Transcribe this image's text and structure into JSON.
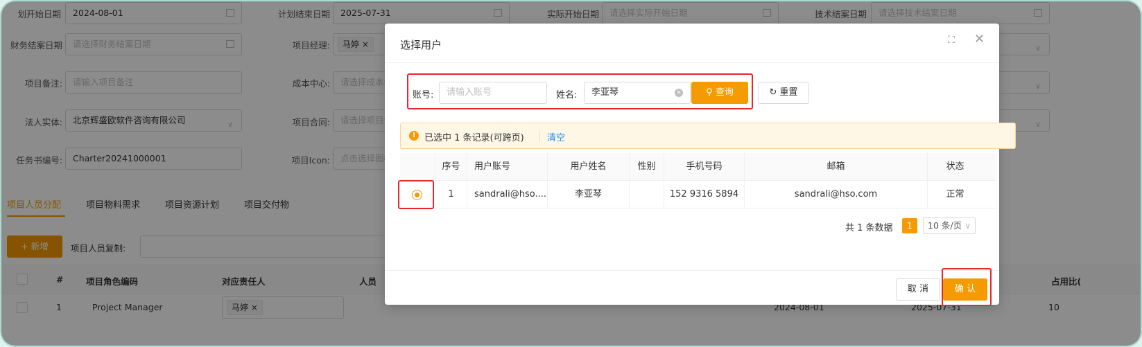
{
  "form": {
    "row1": [
      {
        "label": "划开始日期",
        "value": "2024-08-01",
        "placeholder": ""
      },
      {
        "label": "计划结束日期",
        "value": "2025-07-31",
        "placeholder": ""
      },
      {
        "label": "实际开始日期",
        "value": "",
        "placeholder": "请选择实际开始日期"
      },
      {
        "label": "技术结案日期",
        "value": "",
        "placeholder": "请选择技术结案日期"
      }
    ],
    "finance_date_label": "财务结案日期",
    "finance_date_placeholder": "请选择财务结案日期",
    "pm_label": "项目经理:",
    "pm_tag": "马婷 ×",
    "remark_label": "项目备注:",
    "remark_placeholder": "请输入项目备注",
    "cost_center_label": "成本中心:",
    "cost_center_placeholder": "请选择成本中心",
    "legal_label": "法人实体:",
    "legal_value": "北京辉盛欧软件咨询有限公司",
    "contract_label": "项目合同:",
    "contract_placeholder": "请选择项目合同",
    "charter_label": "任务书编号:",
    "charter_value": "Charter20241000001",
    "icon_label": "项目Icon:",
    "icon_placeholder": "点击选择图标"
  },
  "tabs": [
    "项目人员分配",
    "项目物料需求",
    "项目资源计划",
    "项目交付物"
  ],
  "add_button": "+ 新增",
  "copy_label": "项目人员复制:",
  "bg_table": {
    "headers": [
      "#",
      "项目角色编码",
      "对应责任人",
      "人员",
      "占用比("
    ],
    "row": {
      "index": "1",
      "role": "Project Manager",
      "owner": "马婷 ×",
      "start": "2024-08-01",
      "end": "2025-07-31",
      "ratio": "10"
    }
  },
  "modal": {
    "title": "选择用户",
    "account_label": "账号:",
    "account_placeholder": "请输入账号",
    "name_label": "姓名:",
    "name_value": "李亚琴",
    "query_button": "查询",
    "reset_button": "重置",
    "alert_text": "已选中 1 条记录(可跨页)",
    "alert_clear": "清空",
    "columns": [
      "序号",
      "用户账号",
      "用户姓名",
      "性别",
      "手机号码",
      "邮箱",
      "状态"
    ],
    "rows": [
      {
        "index": "1",
        "account": "sandrali@hso....",
        "name": "李亚琴",
        "gender": "",
        "phone": "152 9316 5894",
        "email": "sandrali@hso.com",
        "status": "正常"
      }
    ],
    "total_text": "共 1 条数据",
    "page": "1",
    "page_size": "10 条/页",
    "cancel_button": "取 消",
    "confirm_button": "确 认"
  },
  "colors": {
    "accent": "#f59a00",
    "highlight": "#e8262d",
    "link": "#1890ff"
  }
}
